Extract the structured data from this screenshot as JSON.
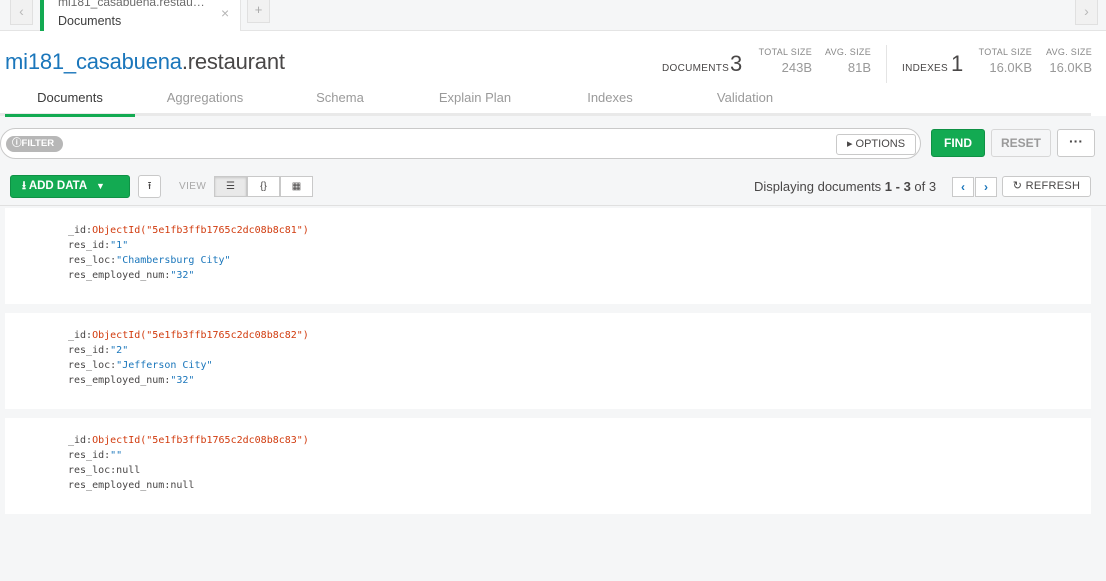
{
  "tabbar": {
    "tab_subtitle": "mi181_casabuena.restaurant",
    "tab_title": "Documents",
    "close_glyph": "×",
    "add_glyph": "+",
    "prev_glyph": "‹",
    "next_glyph": "›"
  },
  "header": {
    "db_name": "mi181_casabuena",
    "coll_name": ".restaurant",
    "documents_label": "DOCUMENTS",
    "documents_count": "3",
    "doc_total_size_label": "TOTAL SIZE",
    "doc_total_size": "243B",
    "doc_avg_size_label": "AVG. SIZE",
    "doc_avg_size": "81B",
    "indexes_label": "INDEXES",
    "indexes_count": "1",
    "idx_total_size_label": "TOTAL SIZE",
    "idx_total_size": "16.0KB",
    "idx_avg_size_label": "AVG. SIZE",
    "idx_avg_size": "16.0KB"
  },
  "subtabs": [
    {
      "label": "Documents",
      "active": true
    },
    {
      "label": "Aggregations"
    },
    {
      "label": "Schema"
    },
    {
      "label": "Explain Plan"
    },
    {
      "label": "Indexes"
    },
    {
      "label": "Validation"
    }
  ],
  "filter": {
    "pill_label": "FILTER",
    "input_value": "",
    "options_label": "OPTIONS",
    "find_label": "FIND",
    "reset_label": "RESET",
    "more_label": "···"
  },
  "toolbar": {
    "add_data_label": "ADD DATA",
    "view_label": "VIEW",
    "display_prefix": "Displaying documents ",
    "display_range": "1 - 3",
    "display_of": " of ",
    "display_total": "3",
    "refresh_label": "REFRESH"
  },
  "documents": [
    {
      "fields": [
        {
          "key": "_id:",
          "value": "ObjectId(\"5e1fb3ffb1765c2dc08b8c81\")"
        },
        {
          "key": "res_id:",
          "value": "\"1\""
        },
        {
          "key": "res_loc:",
          "value": "\"Chambersburg City\""
        },
        {
          "key": "res_employed_num:",
          "value": "\"32\""
        }
      ]
    },
    {
      "fields": [
        {
          "key": "_id:",
          "value": "ObjectId(\"5e1fb3ffb1765c2dc08b8c82\")"
        },
        {
          "key": "res_id:",
          "value": "\"2\""
        },
        {
          "key": "res_loc:",
          "value": "\"Jefferson City\""
        },
        {
          "key": "res_employed_num:",
          "value": "\"32\""
        }
      ]
    },
    {
      "fields": [
        {
          "key": "_id:",
          "value": "ObjectId(\"5e1fb3ffb1765c2dc08b8c83\")"
        },
        {
          "key": "res_id:",
          "value": "\"\""
        },
        {
          "key": "res_loc:",
          "value": "null"
        },
        {
          "key": "res_employed_num:",
          "value": "null"
        }
      ]
    }
  ],
  "colors": {
    "accent_green": "#13aa52",
    "link_blue": "#1a76bb",
    "objectid_orange": "#d13b0e"
  }
}
